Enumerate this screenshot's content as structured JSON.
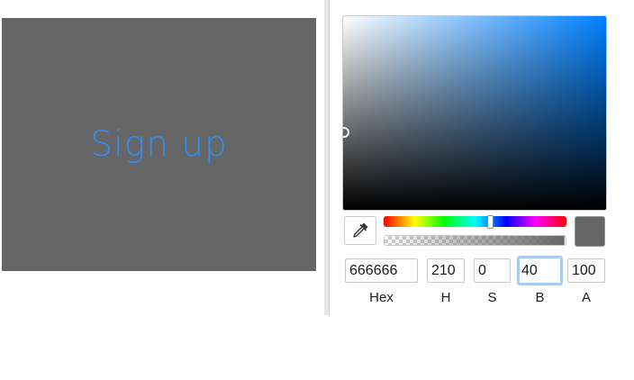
{
  "preview": {
    "label": "Sign up",
    "background": "#666666",
    "text_color": "#2f8ff5"
  },
  "color_picker": {
    "current_color": "#666666",
    "hue_degrees": 210,
    "saturation_percent": 0,
    "brightness_percent": 40,
    "alpha_percent": 100,
    "eyedropper_icon": "eyedropper-icon",
    "fields": {
      "hex": {
        "value": "666666",
        "label": "Hex"
      },
      "h": {
        "value": "210",
        "label": "H"
      },
      "s": {
        "value": "0",
        "label": "S"
      },
      "b": {
        "value": "40",
        "label": "B"
      },
      "a": {
        "value": "100",
        "label": "A"
      }
    }
  }
}
